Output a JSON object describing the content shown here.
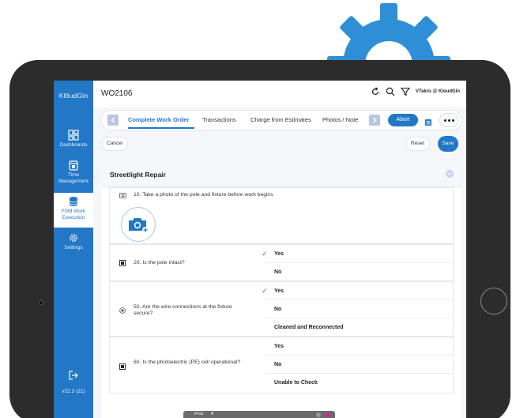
{
  "app": {
    "logo": "Kl8udGin",
    "version": "v22.3 (21)",
    "user": "VTakru @ KloudGin",
    "work_order": "WO2106"
  },
  "sidebar": {
    "items": [
      {
        "label": "Dashboards",
        "icon": "dashboard-icon"
      },
      {
        "label": "Time Management",
        "icon": "calendar-icon"
      },
      {
        "label": "FSM Work Execution",
        "icon": "database-icon",
        "active": true
      },
      {
        "label": "Settings",
        "icon": "gear-icon"
      }
    ]
  },
  "tabs": [
    {
      "label": "Complete Work Order",
      "active": true
    },
    {
      "label": "Transactions"
    },
    {
      "label": "Charge from Estimates"
    },
    {
      "label": "Photos / Note"
    }
  ],
  "actions": {
    "abort": "Abort",
    "cancel": "Cancel",
    "reset": "Reset",
    "save": "Save"
  },
  "section": {
    "title": "Streetlight Repair"
  },
  "questions": [
    {
      "text": "10.  Take a photo of the pole and fixture before work begins",
      "type": "photo"
    },
    {
      "text": "20.  Is the pole intact?",
      "options": [
        "Yes",
        "No"
      ],
      "selected": "Yes"
    },
    {
      "text": "50.  Are the wire connections at the fixture secure?",
      "options": [
        "Yes",
        "No",
        "Cleaned and Reconnected"
      ],
      "selected": "Yes"
    },
    {
      "text": "60.  Is the photoelectric (PE) cell operational?",
      "options": [
        "Yes",
        "No",
        "Unable to Check"
      ],
      "selected": ""
    }
  ],
  "taskbar": {
    "label": "iPad",
    "close": "✕"
  },
  "colors": {
    "brand": "#2277c7",
    "gear": "#2e8fd6",
    "device": "#2c2c2c"
  }
}
